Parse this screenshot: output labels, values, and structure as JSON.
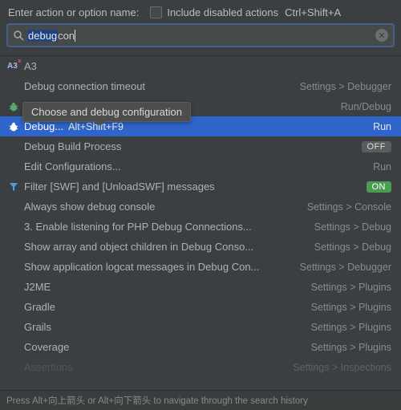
{
  "header": {
    "prompt": "Enter action or option name:",
    "checkbox_label": "Include disabled actions",
    "checkbox_shortcut": "Ctrl+Shift+A"
  },
  "search": {
    "selected_text": "debug",
    "trailing_text": " con",
    "icon": "search-icon",
    "clear_icon": "clear-icon"
  },
  "tooltip": "Choose and debug configuration",
  "rows": [
    {
      "icon": "a3-icon",
      "label": "A3",
      "meta": "",
      "kind": "plain"
    },
    {
      "icon": "",
      "label": "Debug connection timeout",
      "meta": "Settings > Debugger",
      "kind": "plain"
    },
    {
      "icon": "bug-green",
      "label": "",
      "meta": "Run/Debug",
      "kind": "faded"
    },
    {
      "icon": "bug-green-sel",
      "label": "Debug...",
      "shortcut": "Alt+Shift+F9",
      "meta": "Run",
      "kind": "selected"
    },
    {
      "icon": "",
      "label": "Debug Build Process",
      "meta": "",
      "toggle": "OFF",
      "kind": "plain"
    },
    {
      "icon": "",
      "label": "Edit Configurations...",
      "meta": "Run",
      "kind": "plain"
    },
    {
      "icon": "funnel",
      "label": "Filter [SWF] and [UnloadSWF] messages",
      "meta": "",
      "toggle": "ON",
      "kind": "plain"
    },
    {
      "icon": "",
      "label": "Always show debug console",
      "meta": "Settings > Console",
      "kind": "plain"
    },
    {
      "icon": "",
      "label": "3. Enable listening for PHP Debug Connections...",
      "meta": "Settings > Debug",
      "kind": "plain"
    },
    {
      "icon": "",
      "label": "Show array and object children in Debug Conso...",
      "meta": "Settings > Debug",
      "kind": "plain"
    },
    {
      "icon": "",
      "label": "Show application logcat messages in Debug Con...",
      "meta": "Settings > Debugger",
      "kind": "plain"
    },
    {
      "icon": "",
      "label": "J2ME",
      "meta": "Settings > Plugins",
      "kind": "plain"
    },
    {
      "icon": "",
      "label": "Gradle",
      "meta": "Settings > Plugins",
      "kind": "plain"
    },
    {
      "icon": "",
      "label": "Grails",
      "meta": "Settings > Plugins",
      "kind": "plain"
    },
    {
      "icon": "",
      "label": "Coverage",
      "meta": "Settings > Plugins",
      "kind": "plain"
    },
    {
      "icon": "",
      "label": "Assertions",
      "meta": "Settings > Inspections",
      "kind": "faded-bottom"
    }
  ],
  "footer": "Press Alt+向上箭头 or Alt+向下箭头 to navigate through the search history"
}
